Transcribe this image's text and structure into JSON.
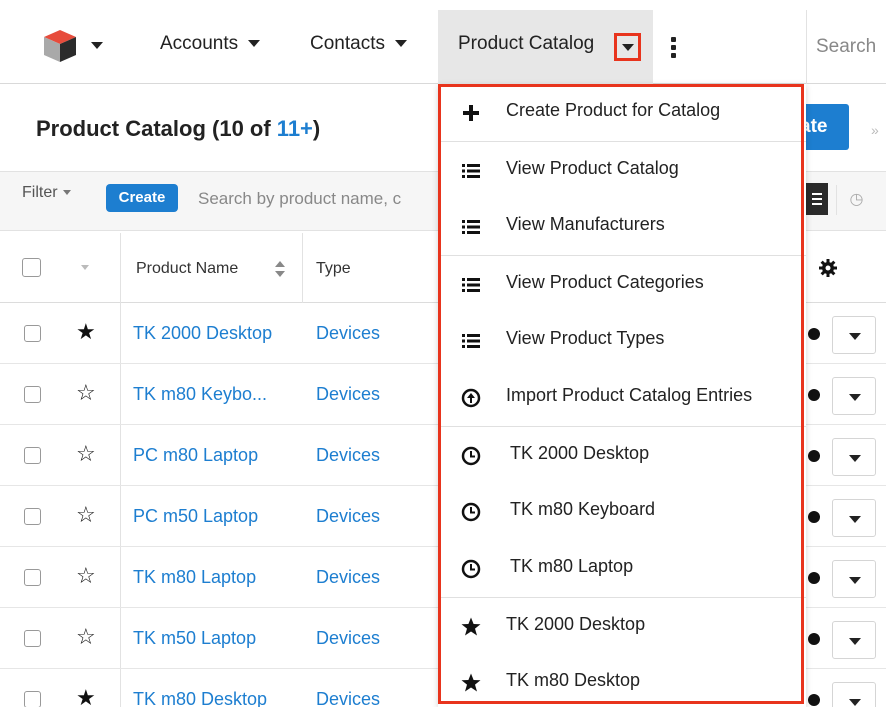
{
  "nav": {
    "items": [
      {
        "label": "Accounts"
      },
      {
        "label": "Contacts"
      },
      {
        "label": "Product Catalog"
      }
    ],
    "search_label": "Search"
  },
  "page": {
    "title": "Product Catalog (10 of ",
    "count_link": "11+",
    "title_suffix": ")",
    "create_label": "ate",
    "chevron": "»"
  },
  "filterbar": {
    "filter_label": "Filter",
    "create_label": "Create",
    "search_placeholder": "Search by product name, c"
  },
  "table": {
    "columns": [
      "Product Name",
      "Type"
    ],
    "rows": [
      {
        "name": "TK 2000 Desktop",
        "type": "Devices",
        "favorite": true
      },
      {
        "name": "TK m80 Keybo...",
        "type": "Devices",
        "favorite": false
      },
      {
        "name": "PC m80 Laptop",
        "type": "Devices",
        "favorite": false
      },
      {
        "name": "PC m50 Laptop",
        "type": "Devices",
        "favorite": false
      },
      {
        "name": "TK m80 Laptop",
        "type": "Devices",
        "favorite": false
      },
      {
        "name": "TK m50 Laptop",
        "type": "Devices",
        "favorite": false
      },
      {
        "name": "TK m80 Desktop",
        "type": "Devices",
        "favorite": true
      }
    ]
  },
  "menu": {
    "items": [
      {
        "label": "Create Product for Catalog",
        "icon": "plus-icon"
      },
      {
        "label": "View Product Catalog",
        "icon": "list-icon"
      },
      {
        "label": "View Manufacturers",
        "icon": "list-icon"
      },
      {
        "label": "View Product Categories",
        "icon": "list-icon"
      },
      {
        "label": "View Product Types",
        "icon": "list-icon"
      },
      {
        "label": "Import Product Catalog Entries",
        "icon": "import-icon"
      },
      {
        "label": "TK 2000 Desktop",
        "icon": "clock-icon"
      },
      {
        "label": "TK m80 Keyboard",
        "icon": "clock-icon"
      },
      {
        "label": "TK m80 Laptop",
        "icon": "clock-icon"
      },
      {
        "label": "TK 2000 Desktop",
        "icon": "star-icon"
      },
      {
        "label": "TK m80 Desktop",
        "icon": "star-icon"
      }
    ]
  },
  "colors": {
    "accent": "#1d7ed0",
    "highlight": "#e8341d"
  }
}
